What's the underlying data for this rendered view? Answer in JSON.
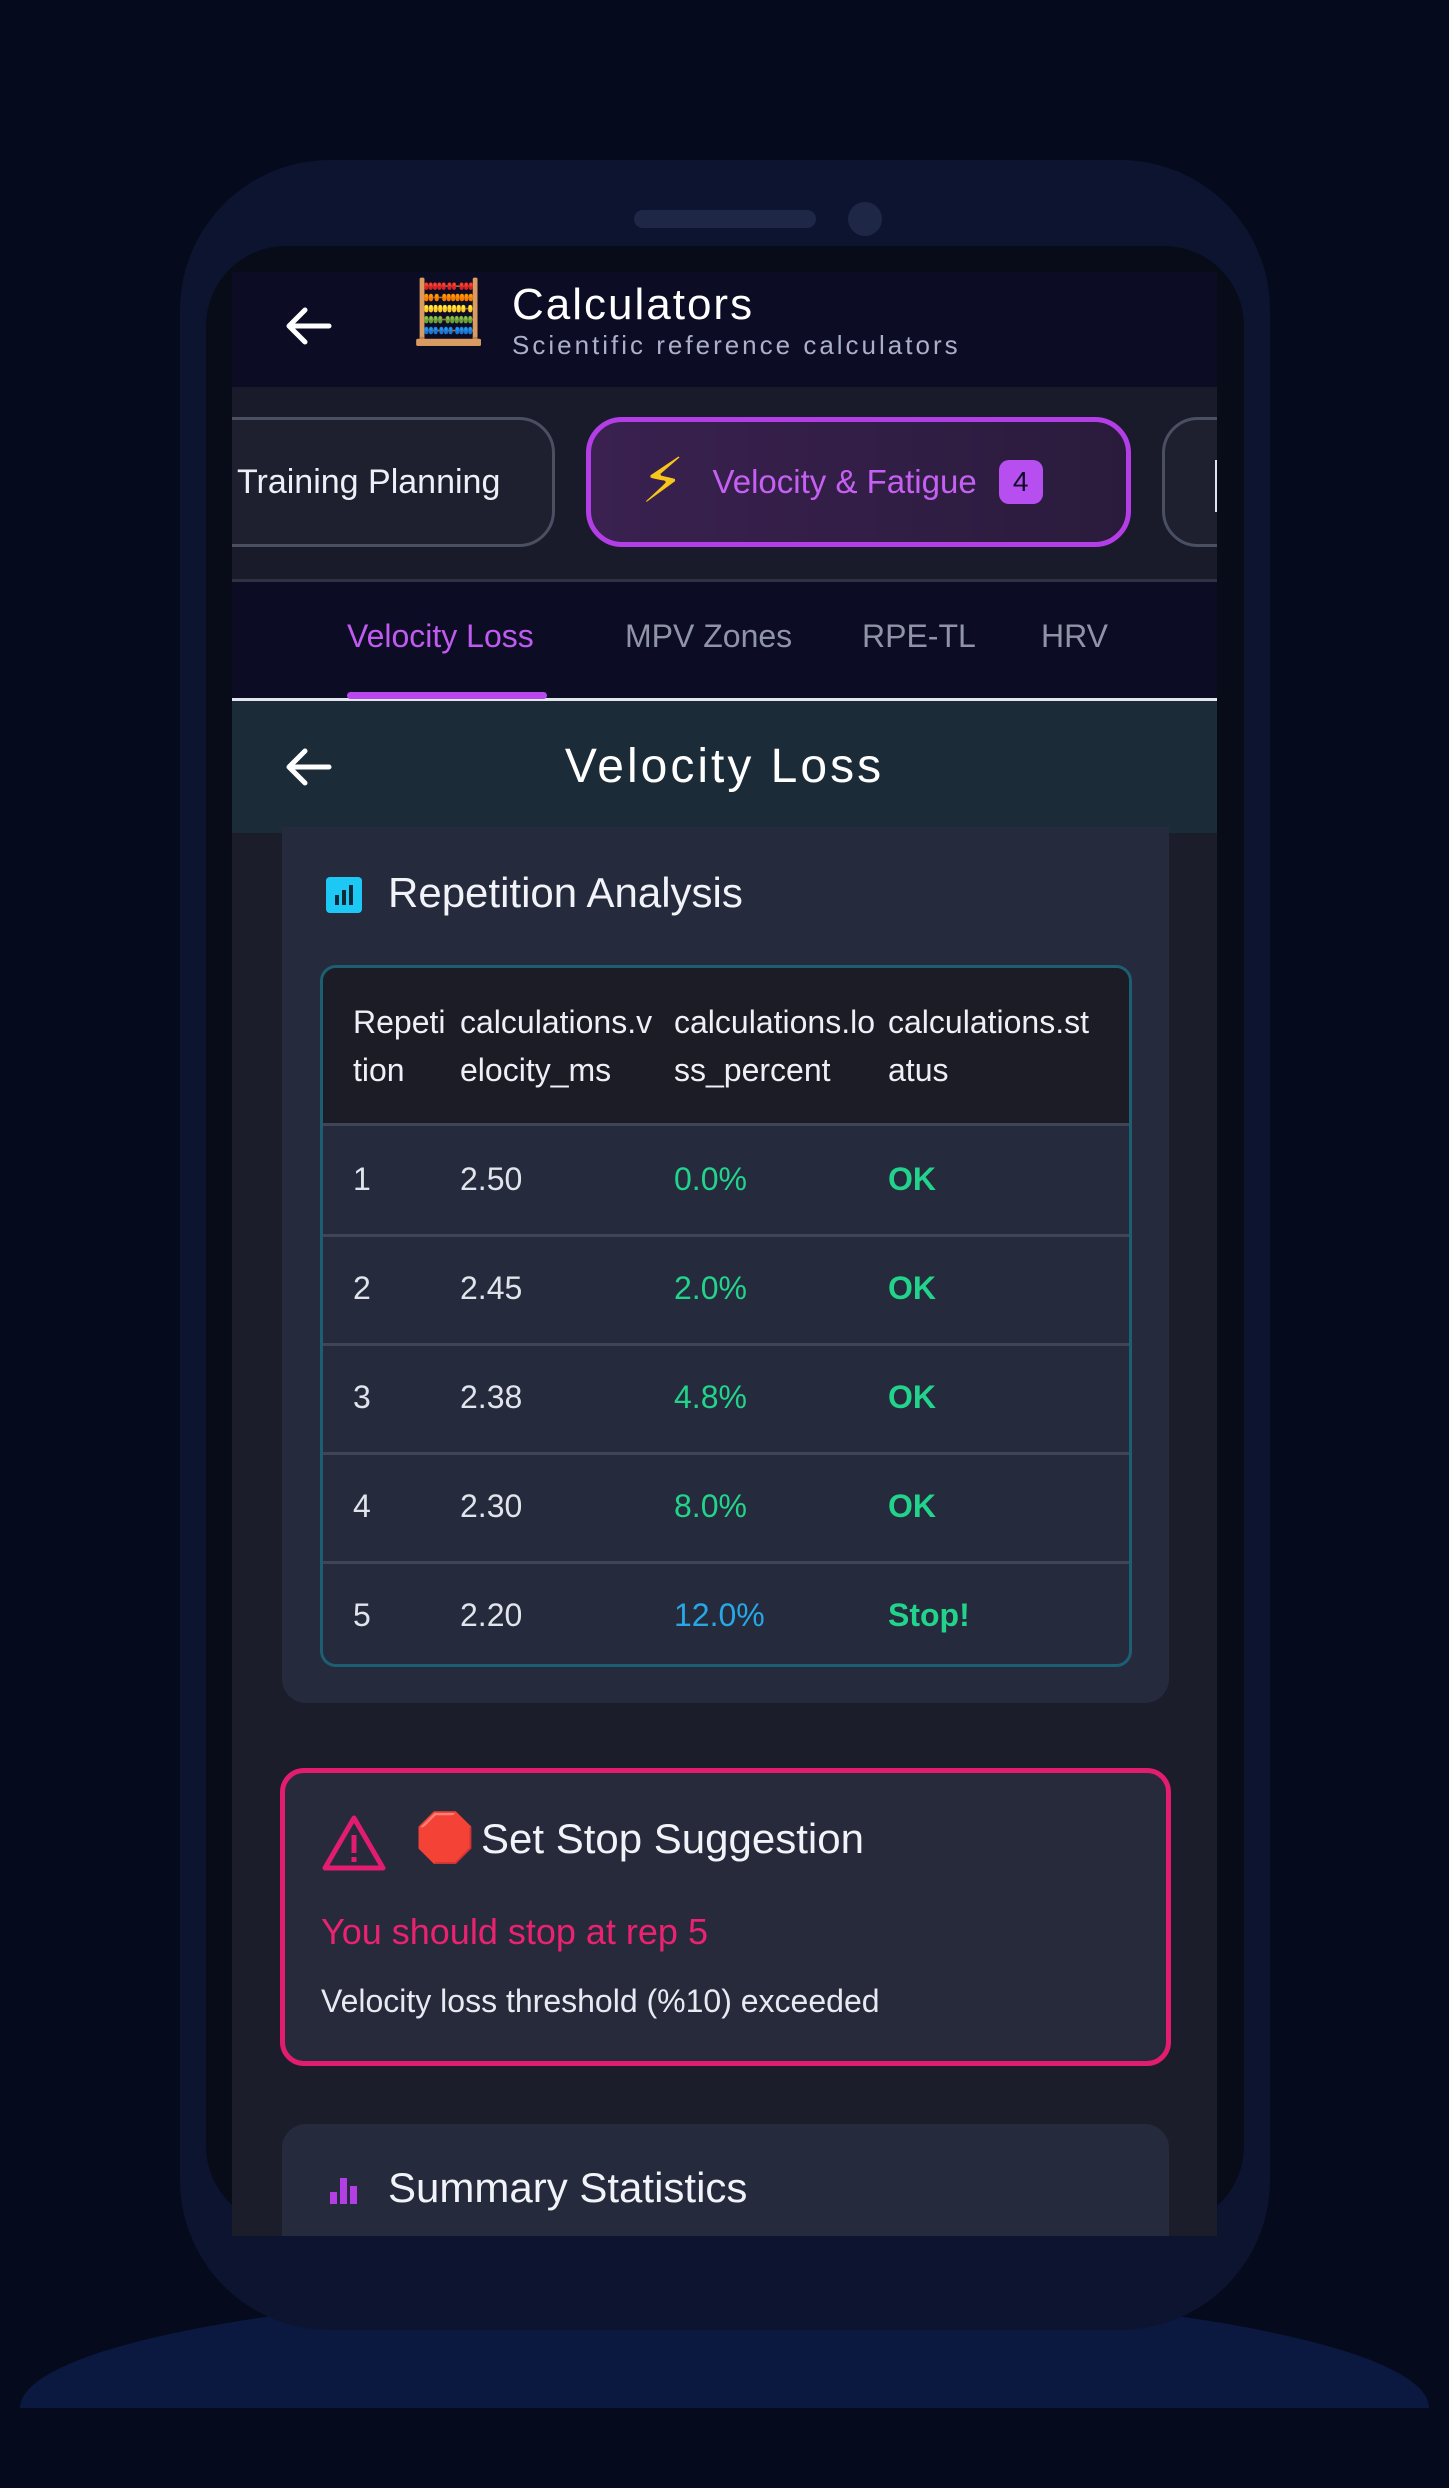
{
  "header": {
    "title": "Calculators",
    "subtitle": "Scientific reference calculators",
    "emoji": "🧮"
  },
  "categories": [
    {
      "label": "Training Planning",
      "active": false
    },
    {
      "label": "Velocity & Fatigue",
      "active": true,
      "badge": "4",
      "emoji": "⚡"
    },
    {
      "label": "",
      "active": false
    }
  ],
  "tabs": [
    {
      "label": "Velocity Loss",
      "active": true
    },
    {
      "label": "MPV Zones",
      "active": false
    },
    {
      "label": "RPE-TL",
      "active": false
    },
    {
      "label": "HRV",
      "active": false
    }
  ],
  "page": {
    "title": "Velocity Loss"
  },
  "analysis": {
    "title": "Repetition Analysis",
    "columns": [
      "Repetition",
      "calculations.velocity_ms",
      "calculations.loss_percent",
      "calculations.status"
    ],
    "rows": [
      {
        "rep": "1",
        "velocity": "2.50",
        "loss": "0.0%",
        "status": "OK",
        "loss_color": "green"
      },
      {
        "rep": "2",
        "velocity": "2.45",
        "loss": "2.0%",
        "status": "OK",
        "loss_color": "green"
      },
      {
        "rep": "3",
        "velocity": "2.38",
        "loss": "4.8%",
        "status": "OK",
        "loss_color": "green"
      },
      {
        "rep": "4",
        "velocity": "2.30",
        "loss": "8.0%",
        "status": "OK",
        "loss_color": "green"
      },
      {
        "rep": "5",
        "velocity": "2.20",
        "loss": "12.0%",
        "status": "Stop!",
        "loss_color": "blue"
      }
    ]
  },
  "stop": {
    "sign": "🛑",
    "title": "Set Stop Suggestion",
    "message": "You should stop at rep 5",
    "description": "Velocity loss threshold (%10) exceeded"
  },
  "summary": {
    "title": "Summary Statistics"
  },
  "colors": {
    "accent": "#b848ee",
    "ok": "#22d38c",
    "warning": "#e21c6e",
    "info": "#27a7e6"
  }
}
